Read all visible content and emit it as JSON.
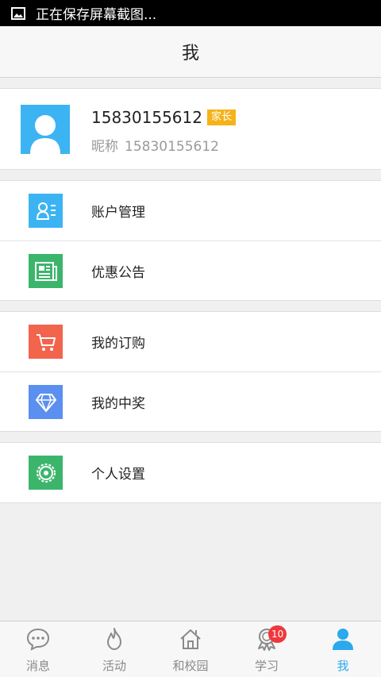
{
  "status_bar": {
    "text": "正在保存屏幕截图..."
  },
  "header": {
    "title": "我"
  },
  "profile": {
    "phone": "15830155612",
    "role_badge": "家长",
    "nickname_label": "昵称",
    "nickname_value": "15830155612"
  },
  "menu": {
    "group1": [
      {
        "label": "账户管理",
        "icon": "account-card-icon",
        "color": "#3cb4f3"
      },
      {
        "label": "优惠公告",
        "icon": "newspaper-icon",
        "color": "#3cb56c"
      }
    ],
    "group2": [
      {
        "label": "我的订购",
        "icon": "cart-icon",
        "color": "#f2644b"
      },
      {
        "label": "我的中奖",
        "icon": "diamond-icon",
        "color": "#5b8ff0"
      }
    ],
    "group3": [
      {
        "label": "个人设置",
        "icon": "settings-gear-icon",
        "color": "#3cb56c"
      }
    ]
  },
  "tabbar": {
    "tabs": [
      {
        "label": "消息",
        "icon": "chat-bubble-icon"
      },
      {
        "label": "活动",
        "icon": "flame-icon"
      },
      {
        "label": "和校园",
        "icon": "house-icon"
      },
      {
        "label": "学习",
        "icon": "award-ribbon-icon",
        "badge": "10"
      },
      {
        "label": "我",
        "icon": "person-icon",
        "active": true
      }
    ]
  },
  "colors": {
    "accent": "#2ba9ec",
    "badge_orange": "#f5b31a",
    "badge_red": "#f0383c"
  }
}
